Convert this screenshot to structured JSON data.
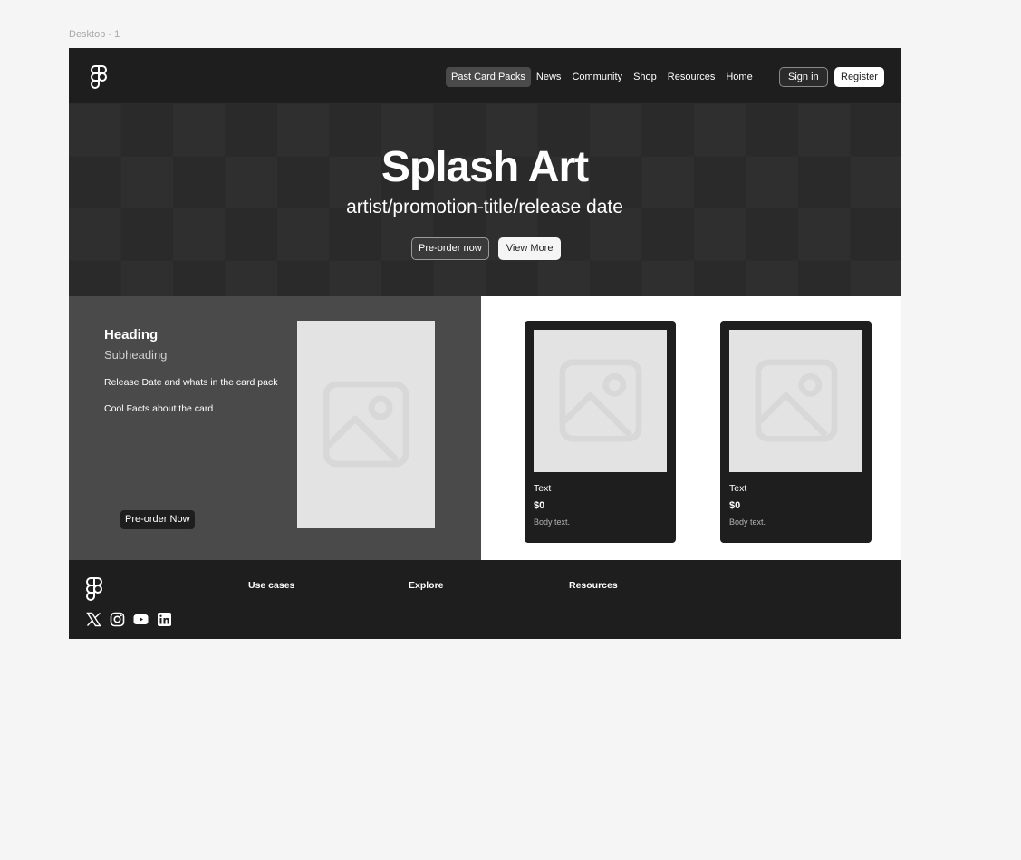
{
  "canvas": {
    "frame_label": "Desktop - 1"
  },
  "nav": {
    "logo_icon": "figma-logo-icon",
    "links": [
      {
        "label": "Past Card Packs",
        "active": true
      },
      {
        "label": "News",
        "active": false
      },
      {
        "label": "Community",
        "active": false
      },
      {
        "label": "Shop",
        "active": false
      },
      {
        "label": "Resources",
        "active": false
      },
      {
        "label": "Home",
        "active": false
      }
    ],
    "sign_in_label": "Sign in",
    "register_label": "Register"
  },
  "hero": {
    "title": "Splash Art",
    "subtitle": "artist/promotion-title/release date",
    "preorder_label": "Pre-order now",
    "view_more_label": "View More"
  },
  "feature": {
    "heading": "Heading",
    "subheading": "Subheading",
    "text_1": "Release Date and whats in the card pack",
    "text_2": "Cool Facts about the card",
    "button_label": "Pre-order Now",
    "image_icon": "image-placeholder-icon"
  },
  "products": {
    "cards": [
      {
        "text": "Text",
        "price": "$0",
        "body": "Body text."
      },
      {
        "text": "Text",
        "price": "$0",
        "body": "Body text."
      }
    ]
  },
  "footer": {
    "logo_icon": "figma-logo-icon",
    "social_icons": [
      "x-twitter-icon",
      "instagram-icon",
      "youtube-icon",
      "linkedin-icon"
    ],
    "columns": [
      "Use cases",
      "Explore",
      "Resources"
    ]
  },
  "colors": {
    "canvas_bg": "#f5f5f5",
    "dark": "#1e1e1e",
    "panel_gray": "#4a4a4a",
    "placeholder": "#e3e3e3",
    "white": "#ffffff"
  }
}
